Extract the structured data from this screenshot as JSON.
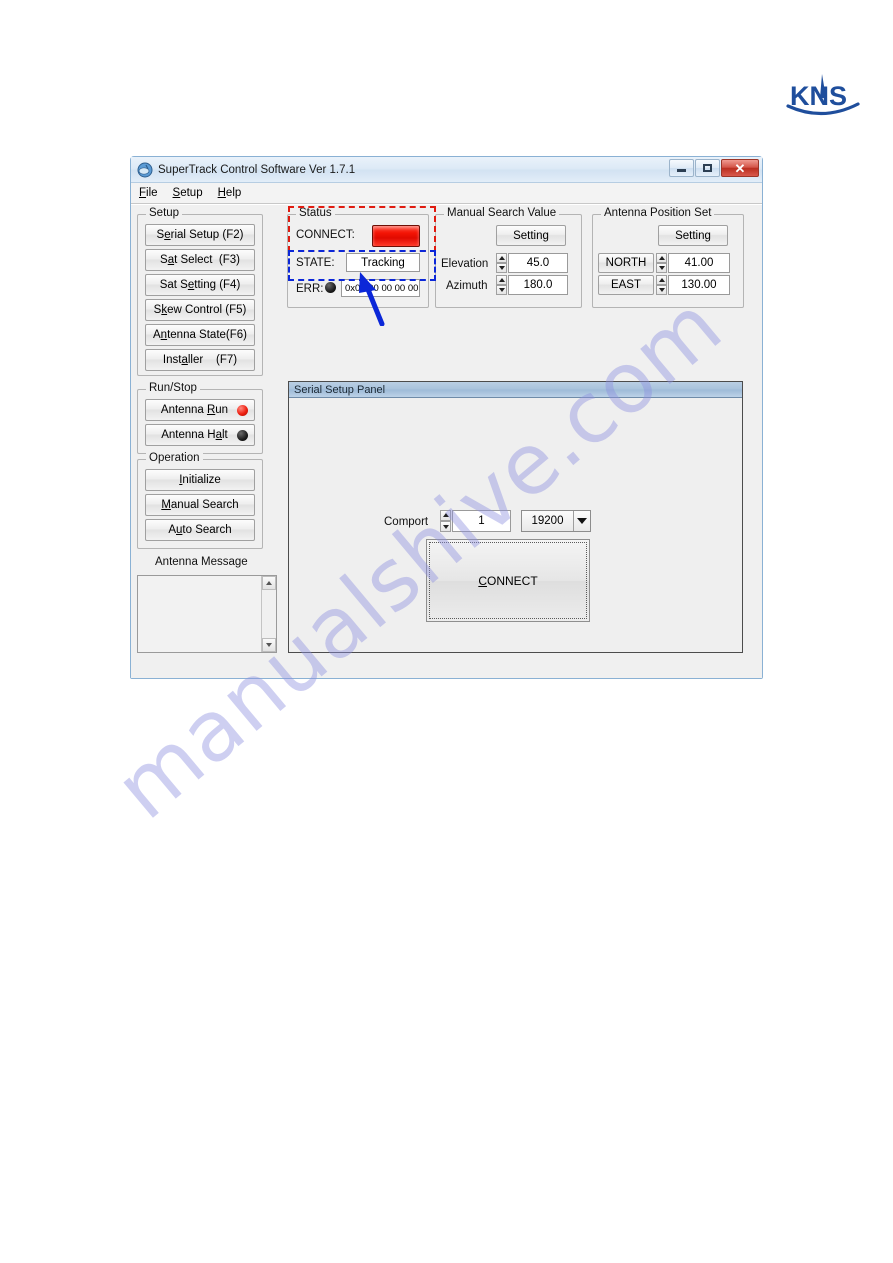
{
  "brand": {
    "logo_text": "KNS",
    "logo_color": "#1f4e9c"
  },
  "watermark": {
    "text": "manualshive.com"
  },
  "window": {
    "title": "SuperTrack Control Software Ver 1.7.1",
    "icon": "satellite-dish-icon",
    "controls": {
      "minimize": "Minimize",
      "maximize": "Maximize",
      "close": "Close"
    }
  },
  "menubar": {
    "items": [
      {
        "label": "File",
        "accel": "F"
      },
      {
        "label": "Setup",
        "accel": "S"
      },
      {
        "label": "Help",
        "accel": "H"
      }
    ]
  },
  "setup_group": {
    "title": "Setup",
    "buttons": [
      {
        "label": "Serial Setup (F2)",
        "accel": "e"
      },
      {
        "label": "Sat Select   (F3)",
        "accel": "a"
      },
      {
        "label": "Sat Setting  (F4)",
        "accel": "e"
      },
      {
        "label": "Skew Control (F5)",
        "accel": "k"
      },
      {
        "label": "Antenna State(F6)",
        "accel": "n"
      },
      {
        "label": "Installer    (F7)",
        "accel": "a"
      }
    ]
  },
  "runstop_group": {
    "title": "Run/Stop",
    "buttons": [
      {
        "label": "Antenna Run",
        "led": "red",
        "led_color": "#ee1f10"
      },
      {
        "label": "Antenna Halt",
        "led": "black",
        "led_color": "#1d1d1d"
      }
    ]
  },
  "operation_group": {
    "title": "Operation",
    "buttons": [
      {
        "label": "Initialize"
      },
      {
        "label": "Manual Search"
      },
      {
        "label": "Auto Search"
      }
    ]
  },
  "antenna_message": {
    "title": "Antenna Message",
    "content": ""
  },
  "status_group": {
    "title": "Status",
    "connect_label": "CONNECT:",
    "connect_indicator_color": "#f41405",
    "state_label": "STATE:",
    "state_value": "Tracking",
    "err_label": "ERR:",
    "err_led_color": "#1d1d1d",
    "err_value": "0x00 00 00 00 00"
  },
  "manual_search_group": {
    "title": "Manual Search Value",
    "setting_button": "Setting",
    "fields": [
      {
        "label": "Elevation",
        "value": "45.0"
      },
      {
        "label": "Azimuth",
        "value": "180.0"
      }
    ]
  },
  "antenna_position_group": {
    "title": "Antenna Position Set",
    "setting_button": "Setting",
    "fields": [
      {
        "label": "NORTH",
        "value": "41.00"
      },
      {
        "label": "EAST",
        "value": "130.00"
      }
    ]
  },
  "serial_panel": {
    "header": "Serial Setup Panel",
    "comport_label": "Comport",
    "comport_value": "1",
    "baud_value": "19200",
    "connect_button": "CONNECT",
    "connect_accel": "C"
  },
  "annotations": {
    "red_box_target": "Status CONNECT indicator",
    "blue_box_target": "STATE Tracking field",
    "arrow_color": "#0b27d8",
    "red_color": "#e01b10",
    "blue_color": "#0b27d8"
  }
}
